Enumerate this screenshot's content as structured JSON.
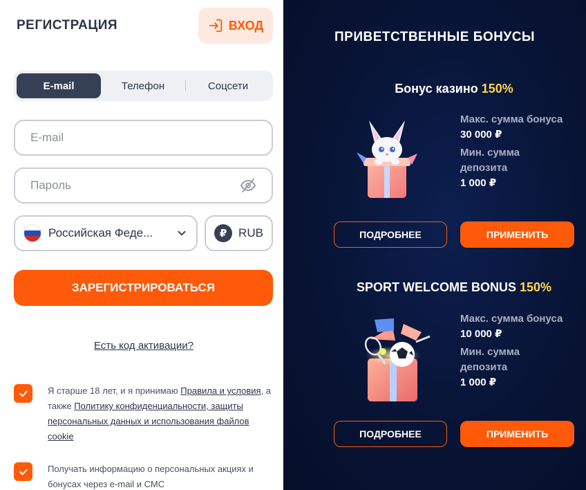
{
  "header": {
    "title": "РЕГИСТРАЦИЯ",
    "login_label": "ВХОД"
  },
  "tabs": [
    {
      "label": "E-mail",
      "active": true
    },
    {
      "label": "Телефон",
      "active": false
    },
    {
      "label": "Соцсети",
      "active": false
    }
  ],
  "form": {
    "email_placeholder": "E-mail",
    "password_placeholder": "Пароль",
    "country_value": "Российская Феде...",
    "currency_symbol": "₽",
    "currency_value": "RUB",
    "register_label": "ЗАРЕГИСТРИРОВАТЬСЯ",
    "activation_link": "Есть код активации?"
  },
  "consent": {
    "terms_prefix": "Я старше 18 лет, и я принимаю ",
    "terms_link": "Правила и условия",
    "terms_mid": ", а также ",
    "privacy_link": "Политику конфиденциальности, защиты персональных данных и использования файлов cookie",
    "marketing": "Получать информацию о персональных акциях и бонусах через e-mail и СМС",
    "terms_checked": true,
    "marketing_checked": true
  },
  "bonuses": {
    "heading": "ПРИВЕТСТВЕННЫЕ БОНУСЫ",
    "items": [
      {
        "title": "Бонус казино",
        "percent": "150%",
        "max_label": "Макс. сумма бонуса",
        "max_value": "30 000 ₽",
        "min_label": "Мин. сумма депозита",
        "min_value": "1 000 ₽",
        "details_label": "ПОДРОБНЕЕ",
        "apply_label": "ПРИМЕНИТЬ"
      },
      {
        "title": "SPORT WELCOME BONUS",
        "percent": "150%",
        "max_label": "Макс. сумма бонуса",
        "max_value": "10 000 ₽",
        "min_label": "Мин. сумма депозита",
        "min_value": "1 000 ₽",
        "details_label": "ПОДРОБНЕЕ",
        "apply_label": "ПРИМЕНИТЬ"
      }
    ]
  },
  "colors": {
    "accent": "#ff5a0a",
    "dark": "#354054",
    "panel_bg": "#081436",
    "highlight": "#ffd84d"
  },
  "icons": {
    "login": "login-arrow-icon",
    "password_toggle": "eye-off-icon",
    "dropdown": "chevron-down-icon",
    "flag": "russia-flag-icon",
    "currency": "ruble-icon",
    "checkbox": "checkmark-icon"
  }
}
